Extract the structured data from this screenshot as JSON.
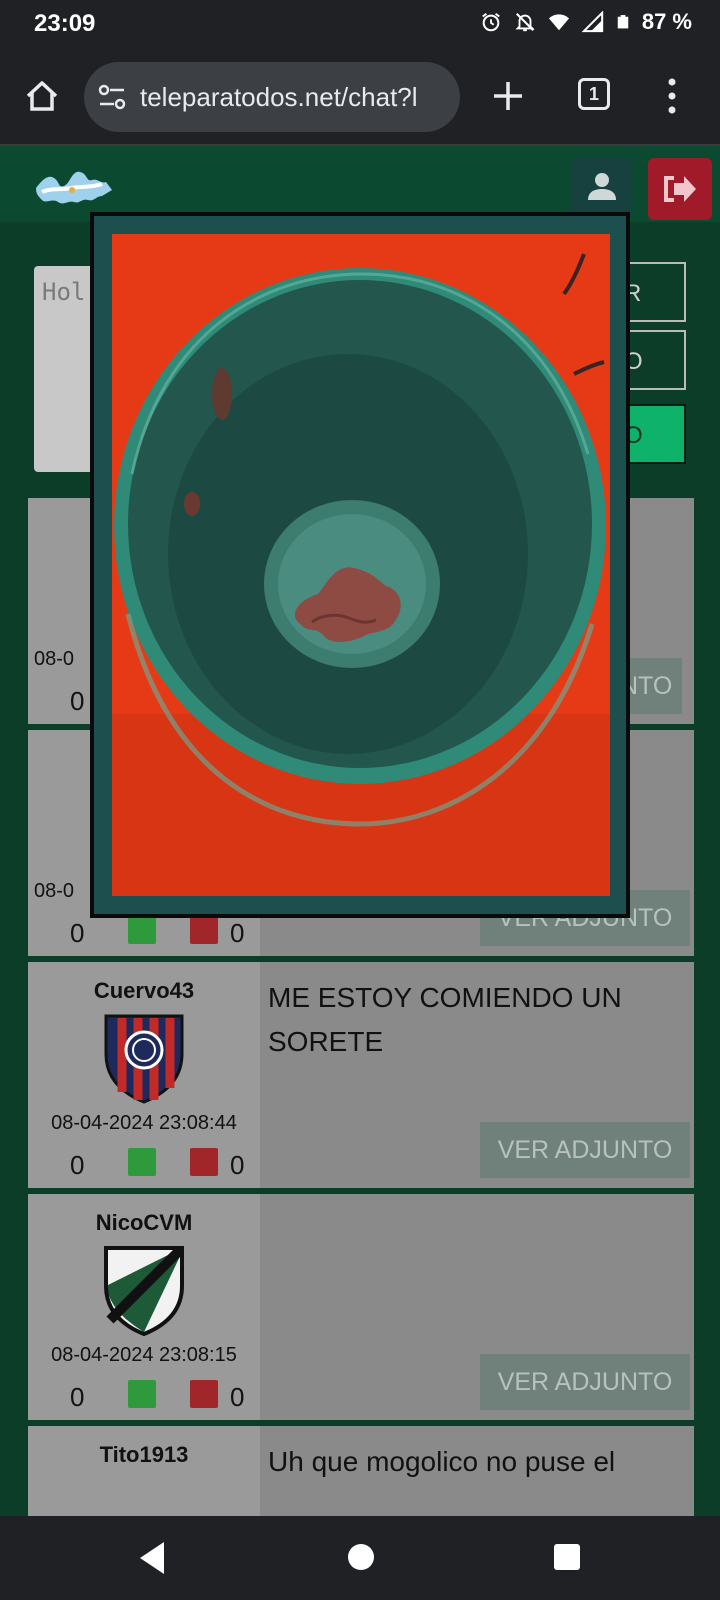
{
  "status_bar": {
    "time": "23:09",
    "battery": "87 %"
  },
  "browser": {
    "url": "teleparatodos.net/chat?l",
    "tab_count": "1"
  },
  "composer": {
    "placeholder_visible": "Hol"
  },
  "side_buttons": [
    "R",
    "O",
    "O"
  ],
  "posts": [
    {
      "username": "",
      "date": "08-0",
      "up_votes": "0",
      "down_votes": "",
      "text": "",
      "attach_label": "NTO"
    },
    {
      "username": "",
      "date": "08-0",
      "up_votes": "0",
      "down_votes": "0",
      "text": "",
      "attach_label": "VER ADJUNTO"
    },
    {
      "username": "Cuervo43",
      "date": "08-04-2024 23:08:44",
      "up_votes": "0",
      "down_votes": "0",
      "text": "ME ESTOY COMIENDO UN SORETE",
      "attach_label": "VER ADJUNTO"
    },
    {
      "username": "NicoCVM",
      "date": "08-04-2024 23:08:15",
      "up_votes": "0",
      "down_votes": "0",
      "text": "",
      "attach_label": "VER ADJUNTO"
    },
    {
      "username": "Tito1913",
      "date": "",
      "up_votes": "",
      "down_votes": "",
      "text": "Uh que mogolico no puse el",
      "attach_label": ""
    }
  ],
  "colors": {
    "header_green": "#0b4a30",
    "logout_red": "#a11a2a",
    "modal_frame": "#1d4f4f",
    "accent_green": "#0fb26b"
  },
  "icons": [
    "alarm-icon",
    "bell-off-icon",
    "wifi-icon",
    "signal-icon",
    "battery-icon",
    "home-icon",
    "site-settings-icon",
    "plus-icon",
    "tabs-icon",
    "more-vert-icon",
    "user-icon",
    "logout-icon",
    "thumb-up-icon",
    "thumb-down-icon",
    "nav-back-icon",
    "nav-home-icon",
    "nav-recents-icon"
  ]
}
